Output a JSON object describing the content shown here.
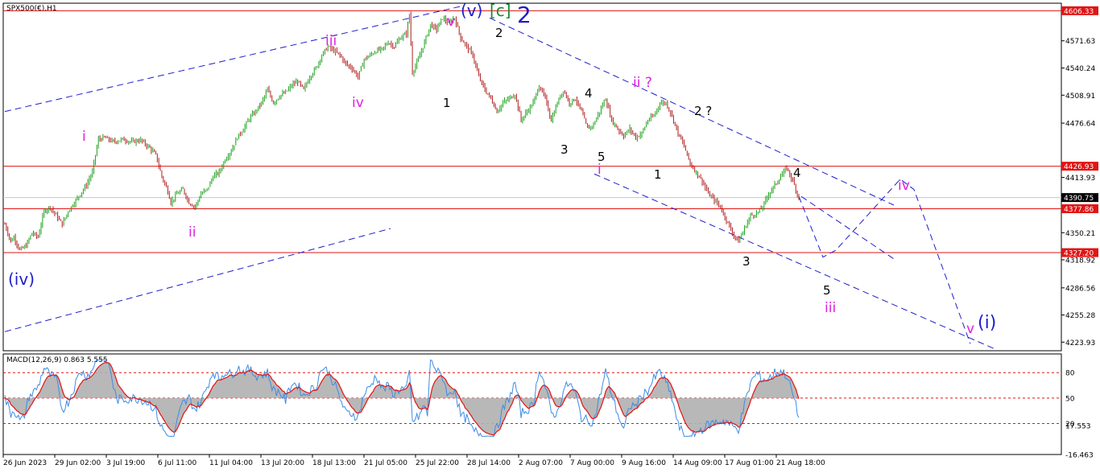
{
  "symbol_label": "SPX500(€),H1",
  "macd_label": "MACD(12,26,9) 0.863 5.555",
  "chart_data": {
    "type": "candlestick",
    "title": "SPX500(€),H1",
    "price_axis": {
      "ylim": [
        4214.0,
        4615.0
      ],
      "ticks": [
        4571.63,
        4540.24,
        4508.91,
        4476.64,
        4413.93,
        4350.21,
        4318.92,
        4286.56,
        4255.28,
        4223.93
      ]
    },
    "horizontal_levels": [
      {
        "label": "4606.33",
        "value": 4606.33
      },
      {
        "label": "4426.93",
        "value": 4426.93
      },
      {
        "label": "4377.86",
        "value": 4377.86
      },
      {
        "label": "4327.20",
        "value": 4327.2
      }
    ],
    "current_price": {
      "label": "4390.75",
      "value": 4390.75
    },
    "time_axis": [
      "26 Jun 2023",
      "29 Jun 02:00",
      "3 Jul 19:00",
      "6 Jul 11:00",
      "11 Jul 04:00",
      "13 Jul 20:00",
      "18 Jul 13:00",
      "21 Jul 05:00",
      "25 Jul 22:00",
      "28 Jul 14:00",
      "2 Aug 07:00",
      "7 Aug 00:00",
      "9 Aug 16:00",
      "14 Aug 09:00",
      "17 Aug 01:00",
      "21 Aug 18:00"
    ],
    "price_path": [
      [
        0,
        4360
      ],
      [
        2,
        4340
      ],
      [
        3,
        4345
      ],
      [
        5,
        4330
      ],
      [
        7,
        4335
      ],
      [
        9,
        4350
      ],
      [
        11,
        4345
      ],
      [
        13,
        4375
      ],
      [
        15,
        4380
      ],
      [
        17,
        4370
      ],
      [
        19,
        4360
      ],
      [
        21,
        4375
      ],
      [
        23,
        4385
      ],
      [
        25,
        4395
      ],
      [
        27,
        4405
      ],
      [
        29,
        4420
      ],
      [
        30,
        4440
      ],
      [
        31,
        4458
      ],
      [
        33,
        4460
      ],
      [
        36,
        4455
      ],
      [
        39,
        4458
      ],
      [
        42,
        4455
      ],
      [
        45,
        4457
      ],
      [
        48,
        4448
      ],
      [
        50,
        4440
      ],
      [
        52,
        4415
      ],
      [
        54,
        4398
      ],
      [
        55,
        4385
      ],
      [
        57,
        4395
      ],
      [
        59,
        4400
      ],
      [
        61,
        4385
      ],
      [
        63,
        4380
      ],
      [
        65,
        4395
      ],
      [
        67,
        4400
      ],
      [
        69,
        4415
      ],
      [
        71,
        4420
      ],
      [
        73,
        4435
      ],
      [
        75,
        4445
      ],
      [
        77,
        4460
      ],
      [
        79,
        4470
      ],
      [
        81,
        4482
      ],
      [
        83,
        4490
      ],
      [
        85,
        4500
      ],
      [
        87,
        4515
      ],
      [
        89,
        4500
      ],
      [
        91,
        4508
      ],
      [
        93,
        4512
      ],
      [
        95,
        4520
      ],
      [
        97,
        4525
      ],
      [
        99,
        4515
      ],
      [
        101,
        4530
      ],
      [
        103,
        4540
      ],
      [
        105,
        4555
      ],
      [
        107,
        4565
      ],
      [
        109,
        4560
      ],
      [
        111,
        4555
      ],
      [
        113,
        4545
      ],
      [
        115,
        4540
      ],
      [
        117,
        4530
      ],
      [
        119,
        4550
      ],
      [
        121,
        4555
      ],
      [
        123,
        4560
      ],
      [
        125,
        4562
      ],
      [
        127,
        4570
      ],
      [
        129,
        4565
      ],
      [
        131,
        4575
      ],
      [
        133,
        4580
      ],
      [
        134,
        4602
      ],
      [
        135,
        4535
      ],
      [
        137,
        4550
      ],
      [
        139,
        4570
      ],
      [
        141,
        4590
      ],
      [
        143,
        4585
      ],
      [
        145,
        4598
      ],
      [
        147,
        4592
      ],
      [
        149,
        4598
      ],
      [
        151,
        4575
      ],
      [
        153,
        4565
      ],
      [
        155,
        4555
      ],
      [
        157,
        4530
      ],
      [
        159,
        4515
      ],
      [
        161,
        4505
      ],
      [
        163,
        4490
      ],
      [
        165,
        4500
      ],
      [
        167,
        4505
      ],
      [
        169,
        4510
      ],
      [
        171,
        4480
      ],
      [
        173,
        4490
      ],
      [
        175,
        4500
      ],
      [
        177,
        4520
      ],
      [
        179,
        4505
      ],
      [
        181,
        4480
      ],
      [
        183,
        4500
      ],
      [
        185,
        4515
      ],
      [
        187,
        4500
      ],
      [
        189,
        4505
      ],
      [
        191,
        4490
      ],
      [
        193,
        4470
      ],
      [
        195,
        4475
      ],
      [
        197,
        4490
      ],
      [
        199,
        4505
      ],
      [
        201,
        4480
      ],
      [
        203,
        4470
      ],
      [
        205,
        4462
      ],
      [
        207,
        4470
      ],
      [
        209,
        4460
      ],
      [
        211,
        4465
      ],
      [
        213,
        4480
      ],
      [
        215,
        4485
      ],
      [
        217,
        4500
      ],
      [
        219,
        4500
      ],
      [
        221,
        4485
      ],
      [
        223,
        4465
      ],
      [
        225,
        4450
      ],
      [
        227,
        4430
      ],
      [
        229,
        4420
      ],
      [
        231,
        4410
      ],
      [
        233,
        4395
      ],
      [
        235,
        4388
      ],
      [
        237,
        4380
      ],
      [
        239,
        4365
      ],
      [
        241,
        4350
      ],
      [
        243,
        4340
      ],
      [
        245,
        4355
      ],
      [
        247,
        4370
      ],
      [
        249,
        4372
      ],
      [
        251,
        4380
      ],
      [
        253,
        4395
      ],
      [
        255,
        4405
      ],
      [
        257,
        4415
      ],
      [
        259,
        4425
      ],
      [
        261,
        4410
      ],
      [
        263,
        4390
      ]
    ],
    "lines": [
      {
        "style": "dashed",
        "from": [
          "6/26",
          4490
        ],
        "to": [
          "7/25",
          4612
        ]
      },
      {
        "style": "dashed",
        "from": [
          "6/26",
          4236
        ],
        "to": [
          "7/21",
          4355
        ]
      },
      {
        "style": "dashed",
        "from": [
          "7/28",
          4598
        ],
        "to": [
          "8/22",
          4382
        ]
      },
      {
        "style": "dashed",
        "from": [
          "8/8",
          4418
        ],
        "to": [
          "8/24",
          4215
        ]
      },
      {
        "style": "dashed",
        "from": [
          "8/21",
          4392
        ],
        "to": [
          "8/22",
          4320
        ],
        "note": "projection"
      }
    ],
    "wave_labels": [
      {
        "text": "(iv)",
        "color": "#1e1ecc"
      },
      {
        "text": "i",
        "color": "#e11ee1"
      },
      {
        "text": "ii",
        "color": "#e11ee1"
      },
      {
        "text": "iii",
        "color": "#e11ee1"
      },
      {
        "text": "iv",
        "color": "#e11ee1"
      },
      {
        "text": "v",
        "color": "#e11ee1"
      },
      {
        "text": "(v)",
        "color": "#1e1ecc"
      },
      {
        "text": "[c]",
        "color": "#1a8a3a"
      },
      {
        "text": "2",
        "color": "#1e1ecc"
      },
      {
        "text": "1",
        "color": "#000000"
      },
      {
        "text": "2",
        "color": "#000000"
      },
      {
        "text": "3",
        "color": "#000000"
      },
      {
        "text": "4",
        "color": "#000000"
      },
      {
        "text": "5",
        "color": "#000000"
      },
      {
        "text": "i",
        "color": "#e11ee1"
      },
      {
        "text": "ii ?",
        "color": "#e11ee1"
      },
      {
        "text": "1",
        "color": "#000000"
      },
      {
        "text": "2 ?",
        "color": "#000000"
      },
      {
        "text": "3",
        "color": "#000000"
      },
      {
        "text": "4",
        "color": "#000000"
      },
      {
        "text": "5",
        "color": "#000000"
      },
      {
        "text": "iii",
        "color": "#e11ee1"
      },
      {
        "text": "iv",
        "color": "#e11ee1"
      },
      {
        "text": "v",
        "color": "#e11ee1"
      },
      {
        "text": "(i)",
        "color": "#1e1ecc"
      }
    ],
    "macd": {
      "params": "MACD(12,26,9)",
      "values": [
        0.863,
        5.555
      ],
      "axis_ticks": [
        17.553,
        80,
        50,
        20,
        -16.463
      ]
    }
  },
  "colors": {
    "bull": "#1ea01e",
    "bear": "#b01e1e",
    "level_line": "#e01414",
    "trend_line": "#1e1ecc",
    "macd_hist": "#b0b0b0",
    "macd_line": "#3c8ce6",
    "signal_line": "#e01414"
  }
}
